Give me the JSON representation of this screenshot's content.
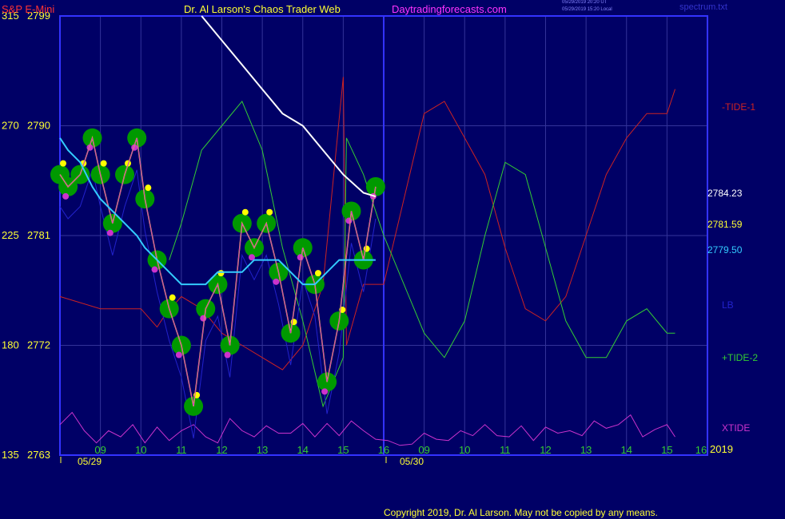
{
  "header": {
    "symbol": "S&P E-Mini",
    "site_title": "Dr. Al Larson's Chaos Trader Web",
    "site_url": "Daytradingforecasts.com",
    "timestamp_utc": "05/29/2019 20:20 UT",
    "timestamp_local": "05/29/2019 15:20 Local",
    "filename": "spectrum.txt"
  },
  "footer": {
    "copyright": "Copyright 2019, Dr. Al Larson. May not be copied by any means."
  },
  "colors": {
    "background": "#000066",
    "frame": "#3333ff",
    "grid": "#333399",
    "price_bands": "#009900",
    "price_upper": "#ffff00",
    "price_lower": "#cc33cc",
    "cyan_avg": "#33ccff",
    "white_avg": "#ffffff",
    "tide1": "#cc2222",
    "tide2": "#33cc33",
    "xtide": "#cc33cc",
    "lb": "#2222cc"
  },
  "chart_data": {
    "type": "line",
    "title": "S&P E-Mini",
    "y_left_labels": [
      {
        "osc": "315",
        "price": "2799",
        "value": 2799
      },
      {
        "osc": "270",
        "price": "2790",
        "value": 2790
      },
      {
        "osc": "225",
        "price": "2781",
        "value": 2781
      },
      {
        "osc": "180",
        "price": "2772",
        "value": 2772
      },
      {
        "osc": "135",
        "price": "2763",
        "value": 2763
      }
    ],
    "ylim": [
      2763,
      2799
    ],
    "x_hour_labels": [
      "09",
      "10",
      "11",
      "12",
      "13",
      "14",
      "15",
      "16",
      "09",
      "10",
      "11",
      "12",
      "13",
      "14",
      "15",
      "16"
    ],
    "x_date_labels": [
      "05/29",
      "05/30"
    ],
    "year_label": "2019",
    "right_labels": {
      "tide1": "-TIDE-1",
      "last_price": "2784.23",
      "white_value": "2781.59",
      "cyan_value": "2779.50",
      "lb": "LB",
      "tide2": "+TIDE-2",
      "xtide": "XTIDE"
    },
    "series": [
      {
        "name": "-TIDE-1",
        "x": [
          0,
          1,
          2,
          2.4,
          2.6,
          3,
          3.5,
          4,
          4.5,
          5,
          5.5,
          6,
          6.5,
          7,
          7.08,
          7.5,
          8,
          8.5,
          9,
          9.5,
          10,
          10.5,
          11,
          11.5,
          12,
          12.5,
          13,
          13.5,
          14,
          14.5,
          15,
          15.2
        ],
        "y": [
          2776,
          2775,
          2775,
          2773.5,
          2774.5,
          2776,
          2775,
          2773,
          2772,
          2771,
          2770,
          2772,
          2777,
          2794,
          2772,
          2777,
          2777,
          2784,
          2791,
          2792,
          2789,
          2786,
          2780,
          2775,
          2774,
          2776,
          2781,
          2786,
          2789,
          2791,
          2791,
          2793
        ]
      },
      {
        "name": "+TIDE-2",
        "x": [
          2.7,
          3,
          3.5,
          4,
          4.5,
          5,
          5.5,
          6,
          6.5,
          7,
          7.08,
          7.5,
          8,
          8.5,
          9,
          9.5,
          10,
          10.5,
          11,
          11.5,
          12,
          12.5,
          13,
          13.5,
          14,
          14.5,
          15,
          15.2
        ],
        "y": [
          2779,
          2782,
          2788,
          2790,
          2792,
          2788,
          2780,
          2774,
          2767,
          2771,
          2789,
          2786,
          2781,
          2777,
          2773,
          2771,
          2774,
          2781,
          2787,
          2786,
          2780,
          2774,
          2771,
          2771,
          2774,
          2775,
          2773,
          2773
        ]
      },
      {
        "name": "XTIDE",
        "x": [
          0,
          0.3,
          0.6,
          0.9,
          1.2,
          1.5,
          1.8,
          2.1,
          2.4,
          2.7,
          3,
          3.3,
          3.6,
          3.9,
          4.2,
          4.5,
          4.8,
          5.1,
          5.4,
          5.7,
          6,
          6.3,
          6.6,
          6.9,
          7.2,
          7.5,
          7.8,
          8.1,
          8.4,
          8.7,
          9,
          9.3,
          9.6,
          9.9,
          10.2,
          10.5,
          10.8,
          11.1,
          11.4,
          11.7,
          12,
          12.3,
          12.6,
          12.9,
          13.2,
          13.5,
          13.8,
          14.1,
          14.4,
          14.7,
          15,
          15.2
        ],
        "y": [
          2765.5,
          2766.5,
          2765,
          2764,
          2765,
          2764.5,
          2765.5,
          2764,
          2765.3,
          2764.2,
          2765,
          2765.5,
          2764.5,
          2764,
          2766,
          2765,
          2764.5,
          2765.4,
          2764.8,
          2764.8,
          2765.6,
          2764.5,
          2765.6,
          2764.6,
          2765.8,
          2765,
          2764.3,
          2764.2,
          2763.8,
          2763.9,
          2764.8,
          2764.3,
          2764.2,
          2765,
          2764.6,
          2765.5,
          2764.6,
          2764.5,
          2765.4,
          2764.2,
          2765.3,
          2764.8,
          2765,
          2764.6,
          2765.8,
          2765.2,
          2765.5,
          2766.3,
          2764.5,
          2765.1,
          2765.5,
          2764.5
        ]
      }
    ]
  }
}
